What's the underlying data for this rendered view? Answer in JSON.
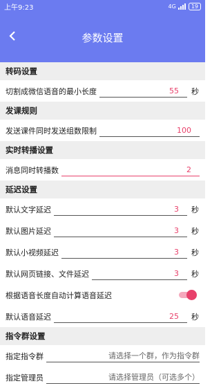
{
  "status": {
    "time": "上午9:23",
    "network": "4G",
    "battery": "19"
  },
  "header": {
    "title": "参数设置"
  },
  "colors": {
    "primary": "#6b7bf0",
    "accent": "#e8416b"
  },
  "sections": {
    "transcode": {
      "title": "转码设置",
      "min_length_label": "切割成微信语音的最小长度",
      "min_length_value": "55",
      "min_length_unit": "秒"
    },
    "course": {
      "title": "发课规则",
      "group_limit_label": "发送课件同时发送组数限制",
      "group_limit_value": "100"
    },
    "live": {
      "title": "实时转播设置",
      "forward_label": "消息同时转播数",
      "forward_value": "2"
    },
    "delay": {
      "title": "延迟设置",
      "text_label": "默认文字延迟",
      "text_value": "3",
      "text_unit": "秒",
      "image_label": "默认图片延迟",
      "image_value": "3",
      "image_unit": "秒",
      "video_label": "默认小视频延迟",
      "video_value": "3",
      "video_unit": "秒",
      "link_label": "默认网页链接、文件延迟",
      "link_value": "3",
      "link_unit": "秒",
      "auto_label": "根据语音长度自动计算语音延迟",
      "auto_on": true,
      "voice_label": "默认语音延迟",
      "voice_value": "25",
      "voice_unit": "秒"
    },
    "command": {
      "title": "指令群设置",
      "group_label": "指定指令群",
      "group_placeholder": "请选择一个群，作为指令群",
      "admin_label": "指定管理员",
      "admin_placeholder": "请选择管理员（可选多个）"
    }
  }
}
